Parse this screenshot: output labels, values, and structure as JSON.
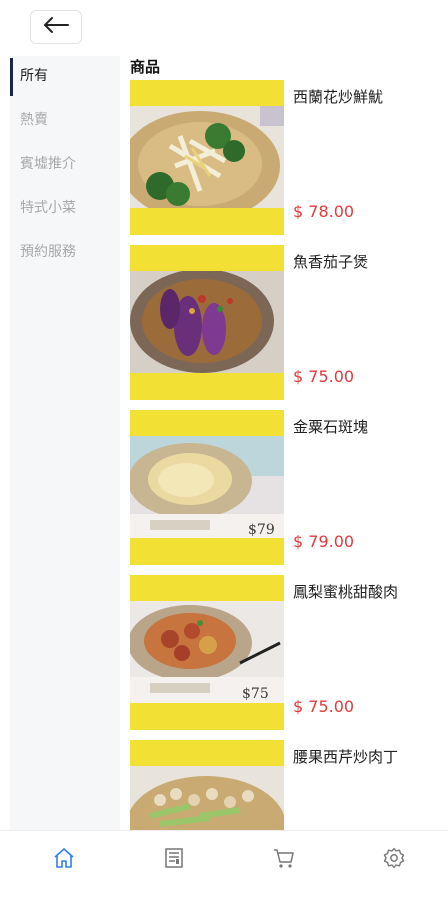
{
  "nav": {
    "back_icon": "arrow-left-icon"
  },
  "sidebar": {
    "items": [
      {
        "label": "所有",
        "active": true
      },
      {
        "label": "熱賣",
        "active": false
      },
      {
        "label": "賓墟推介",
        "active": false
      },
      {
        "label": "特式小菜",
        "active": false
      },
      {
        "label": "預約服務",
        "active": false
      }
    ]
  },
  "main": {
    "section_title": "商品",
    "products": [
      {
        "name": "西蘭花炒鮮魷",
        "price": "$ 78.00"
      },
      {
        "name": "魚香茄子煲",
        "price": "$ 75.00"
      },
      {
        "name": "金粟石斑塊",
        "price": "$ 79.00"
      },
      {
        "name": "鳳梨蜜桃甜酸肉",
        "price": "$ 75.00"
      },
      {
        "name": "腰果西芹炒肉丁",
        "price": ""
      }
    ]
  },
  "tabbar": {
    "tabs": [
      {
        "icon": "home-icon",
        "active": true
      },
      {
        "icon": "menu-book-icon",
        "active": false
      },
      {
        "icon": "cart-icon",
        "active": false
      },
      {
        "icon": "settings-icon",
        "active": false
      }
    ]
  },
  "colors": {
    "accent": "#2f7ef0",
    "price": "#e23b3b",
    "placeholder": "#f2e035",
    "sidebar_bg": "#f6f7f9"
  }
}
